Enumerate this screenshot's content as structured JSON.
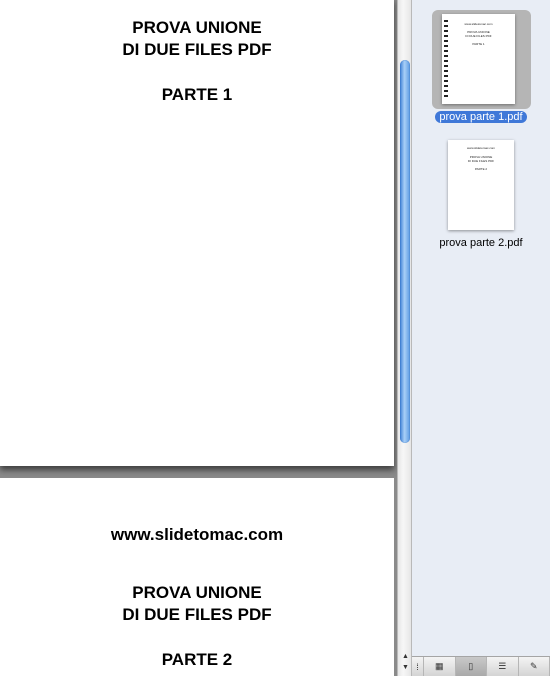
{
  "document": {
    "page1": {
      "line1": "PROVA UNIONE",
      "line2": "DI DUE FILES PDF",
      "line3": "PARTE 1"
    },
    "page2": {
      "website": "www.slidetomac.com",
      "line1": "PROVA UNIONE",
      "line2": "DI DUE FILES PDF",
      "line3": "PARTE 2"
    }
  },
  "sidebar": {
    "thumbnails": [
      {
        "label": "prova parte 1.pdf",
        "selected": true,
        "mini": {
          "website": "www.slidetomac.com",
          "line1": "PROVA UNIONE",
          "line2": "DI DUE FILES PDF",
          "line3": "PARTE 1"
        }
      },
      {
        "label": "prova parte 2.pdf",
        "selected": false,
        "mini": {
          "website": "www.slidetomac.com",
          "line1": "PROVA UNIONE",
          "line2": "DI DUE FILES PDF",
          "line3": "PARTE 2"
        }
      }
    ],
    "toolbar": {
      "buttons": [
        {
          "icon": "resize-grip-icon",
          "glyph": "⁞"
        },
        {
          "icon": "contact-sheet-icon",
          "glyph": "▦"
        },
        {
          "icon": "thumbnails-icon",
          "glyph": "▯"
        },
        {
          "icon": "table-of-contents-icon",
          "glyph": "☰"
        },
        {
          "icon": "annotations-pen-icon",
          "glyph": "✎"
        }
      ]
    }
  },
  "colors": {
    "selection": "#3f78d8",
    "scroll_thumb": "#5b99e2",
    "sidebar_bg": "#e8edf5"
  }
}
